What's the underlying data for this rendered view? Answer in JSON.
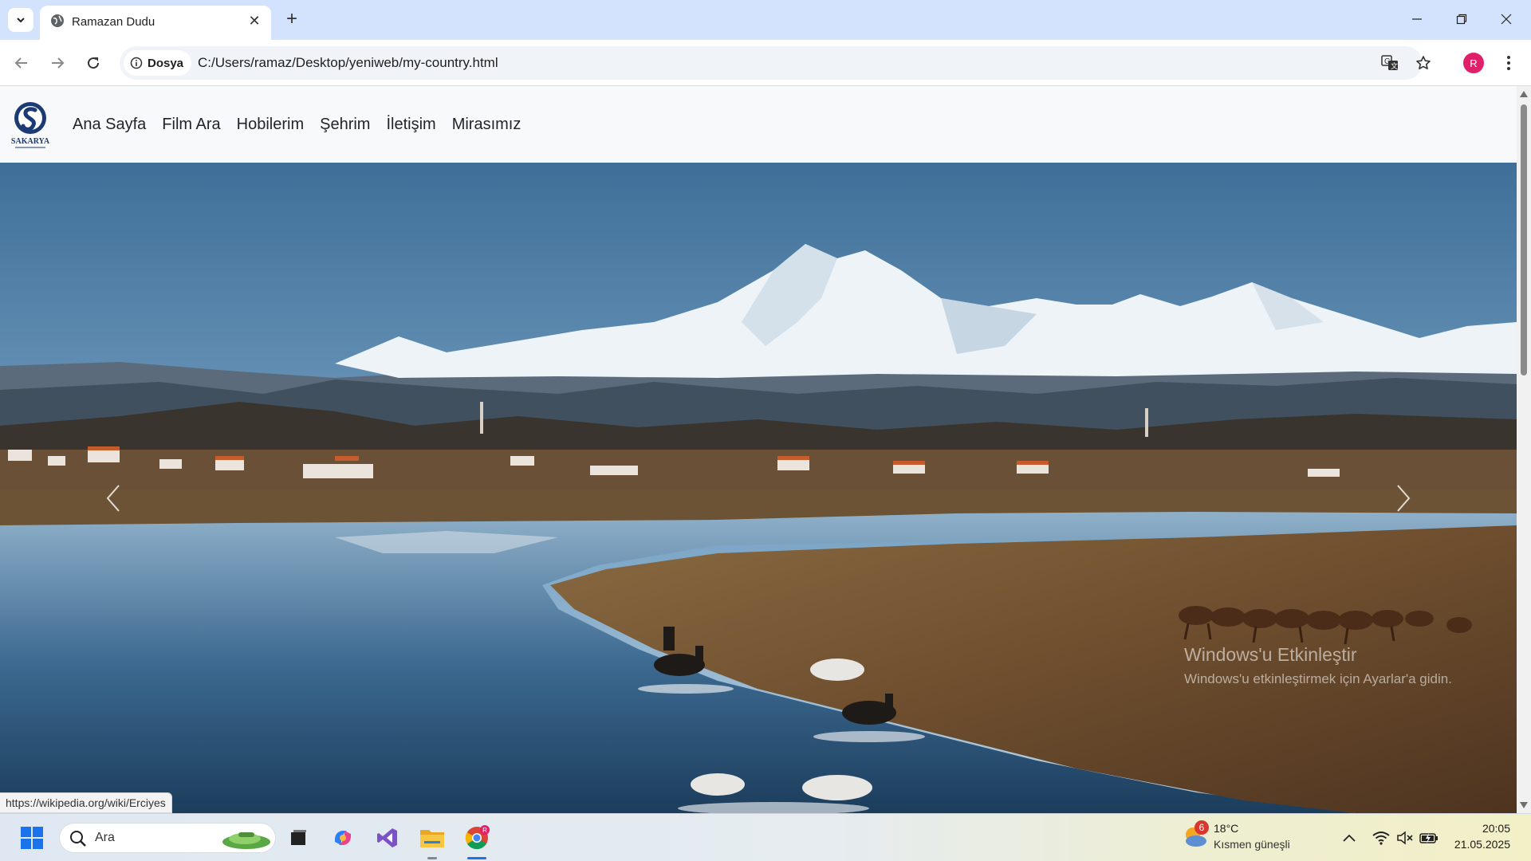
{
  "browser": {
    "tab_title": "Ramazan Dudu",
    "security_chip": "Dosya",
    "url": "C:/Users/ramaz/Desktop/yeniweb/my-country.html",
    "profile_initial": "R",
    "status_url": "https://wikipedia.org/wiki/Erciyes"
  },
  "site": {
    "logo_text": "SAKARYA",
    "nav": [
      "Ana Sayfa",
      "Film Ara",
      "Hobilerim",
      "Şehrim",
      "İletişim",
      "Mirasımız"
    ]
  },
  "overlay": {
    "activation_title": "Windows'u Etkinleştir",
    "activation_sub": "Windows'u etkinleştirmek için Ayarlar'a gidin."
  },
  "taskbar": {
    "search_placeholder": "Ara",
    "weather_badge": "6",
    "weather_temp": "18°C",
    "weather_desc": "Kısmen güneşli",
    "time": "20:05",
    "date": "21.05.2025"
  }
}
